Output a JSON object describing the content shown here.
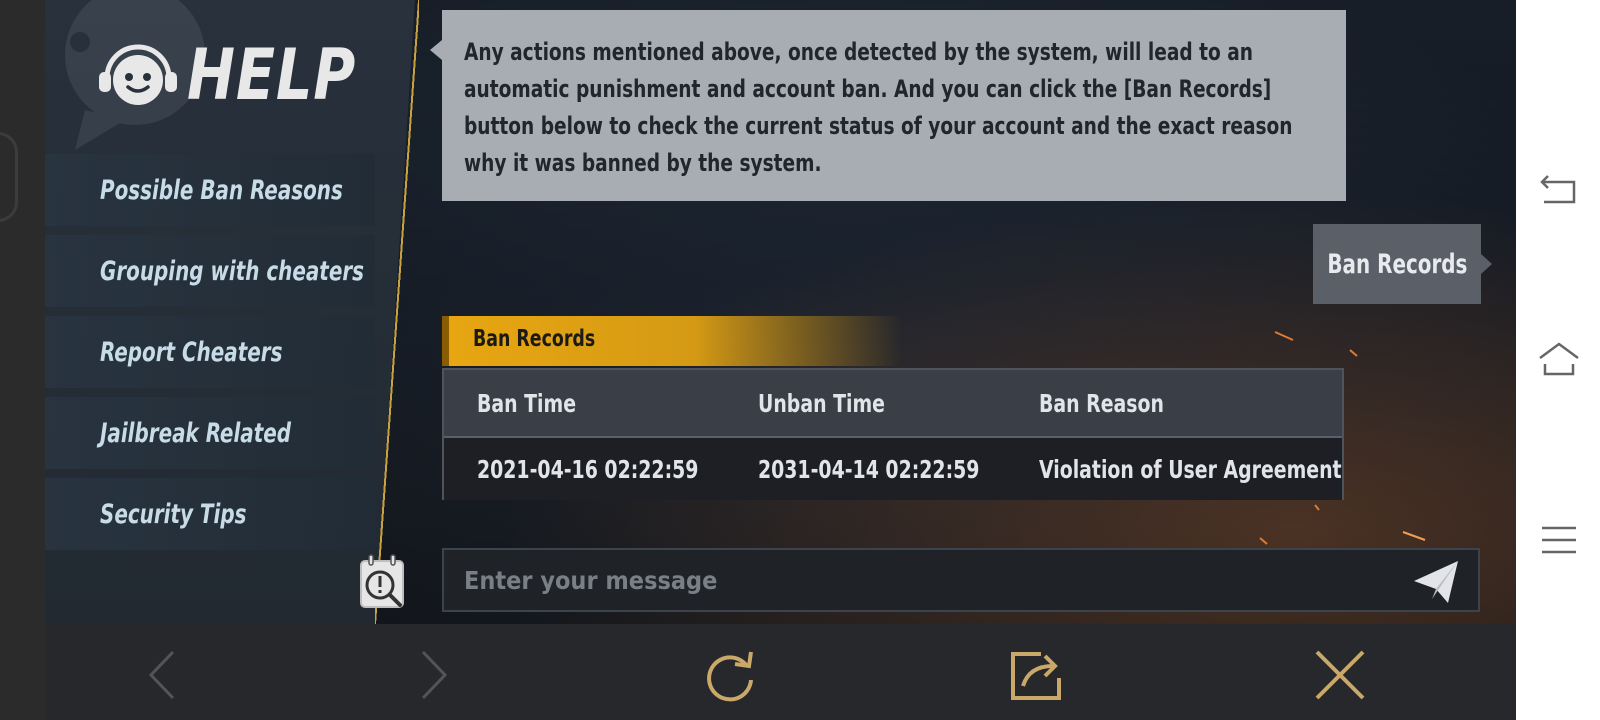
{
  "sidebar": {
    "logo_text": "HELP",
    "items": [
      {
        "label": "Possible Ban Reasons"
      },
      {
        "label": "Grouping with cheaters"
      },
      {
        "label": "Report Cheaters"
      },
      {
        "label": "Jailbreak Related"
      },
      {
        "label": "Security Tips"
      }
    ]
  },
  "message": {
    "text": "Any actions mentioned above, once detected by the system, will lead to an automatic punishment and account ban. And you can click the [Ban Records] button below to check the current status of your account and the exact reason why it was banned by the system."
  },
  "ban_records_button": {
    "label": "Ban Records"
  },
  "ban_records_card": {
    "title": "Ban Records",
    "columns": [
      "Ban Time",
      "Unban Time",
      "Ban Reason"
    ],
    "rows": [
      [
        "2021-04-16 02:22:59",
        "2031-04-14 02:22:59",
        "Violation of User Agreement"
      ]
    ]
  },
  "chat": {
    "placeholder": "Enter your message"
  },
  "bottom_bar": {
    "icons": [
      "back-arrow-icon",
      "forward-arrow-icon",
      "refresh-icon",
      "share-icon",
      "close-icon"
    ]
  },
  "system_nav": {
    "icons": [
      "back-icon",
      "home-icon",
      "menu-icon"
    ]
  },
  "colors": {
    "accent": "#c8a23e",
    "header_gold": "#e8a612",
    "bubble": "#a8acb3"
  }
}
